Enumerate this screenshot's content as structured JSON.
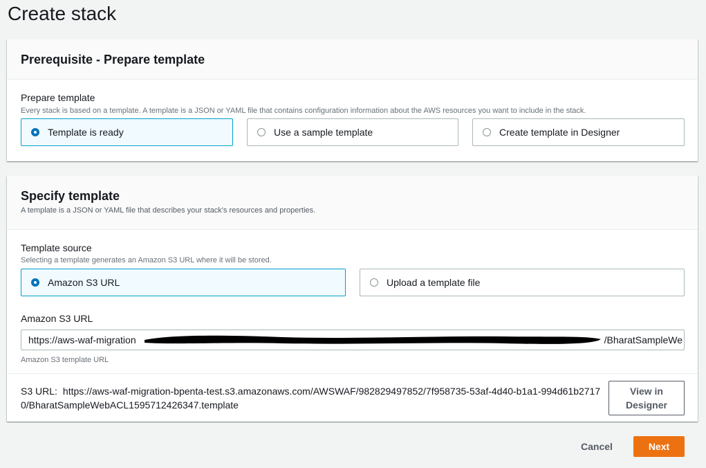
{
  "page": {
    "title": "Create stack"
  },
  "prerequisite": {
    "title": "Prerequisite - Prepare template",
    "field_label": "Prepare template",
    "field_hint": "Every stack is based on a template. A template is a JSON or YAML file that contains configuration information about the AWS resources you want to include in the stack.",
    "options": [
      {
        "label": "Template is ready",
        "selected": true
      },
      {
        "label": "Use a sample template",
        "selected": false
      },
      {
        "label": "Create template in Designer",
        "selected": false
      }
    ]
  },
  "specify": {
    "title": "Specify template",
    "description": "A template is a JSON or YAML file that describes your stack's resources and properties.",
    "source_label": "Template source",
    "source_hint": "Selecting a template generates an Amazon S3 URL where it will be stored.",
    "source_options": [
      {
        "label": "Amazon S3 URL",
        "selected": true
      },
      {
        "label": "Upload a template file",
        "selected": false
      }
    ],
    "url_label": "Amazon S3 URL",
    "url_value_start": "https://aws-waf-migration",
    "url_value_end": "/BharatSampleWe",
    "url_hint": "Amazon S3 template URL",
    "s3_label": "S3 URL:",
    "s3_url": "https://aws-waf-migration-bpenta-test.s3.amazonaws.com/AWSWAF/982829497852/7f958735-53af-4d40-b1a1-994d61b27170/BharatSampleWebACL1595712426347.template",
    "view_button": "View in Designer"
  },
  "footer": {
    "cancel": "Cancel",
    "next": "Next"
  },
  "colors": {
    "accent": "#0073bb",
    "primary_button": "#ec7211",
    "selected_border": "#00a1c9"
  }
}
